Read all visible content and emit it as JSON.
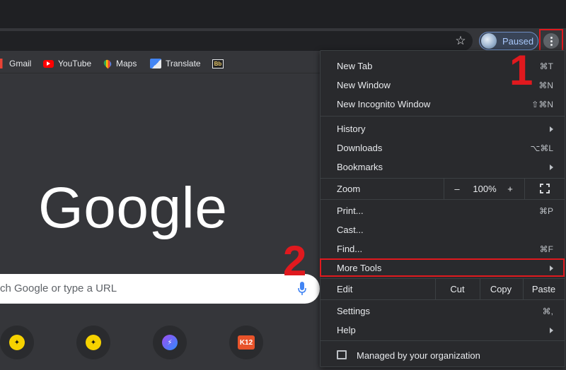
{
  "toolbar": {
    "profile_label": "Paused"
  },
  "bookmarks": [
    {
      "label": "Gmail"
    },
    {
      "label": "YouTube"
    },
    {
      "label": "Maps"
    },
    {
      "label": "Translate"
    }
  ],
  "page": {
    "logo": "Google",
    "search_placeholder": "ch Google or type a URL",
    "shortcut_k12": "K12"
  },
  "menu": {
    "new_tab": "New Tab",
    "new_tab_shortcut": "⌘T",
    "new_window": "New Window",
    "new_window_shortcut": "⌘N",
    "new_incognito": "New Incognito Window",
    "new_incognito_shortcut": "⇧⌘N",
    "history": "History",
    "downloads": "Downloads",
    "downloads_shortcut": "⌥⌘L",
    "bookmarks": "Bookmarks",
    "zoom_label": "Zoom",
    "zoom_minus": "–",
    "zoom_value": "100%",
    "zoom_plus": "+",
    "print": "Print...",
    "print_shortcut": "⌘P",
    "cast": "Cast...",
    "find": "Find...",
    "find_shortcut": "⌘F",
    "more_tools": "More Tools",
    "edit_label": "Edit",
    "cut": "Cut",
    "copy": "Copy",
    "paste": "Paste",
    "settings": "Settings",
    "settings_shortcut": "⌘,",
    "help": "Help",
    "managed": "Managed by your organization"
  },
  "annotations": {
    "step1": "1",
    "step2": "2"
  },
  "colors": {
    "highlight": "#e0191e",
    "menu_bg": "#292a2d",
    "page_bg": "#35363a"
  }
}
